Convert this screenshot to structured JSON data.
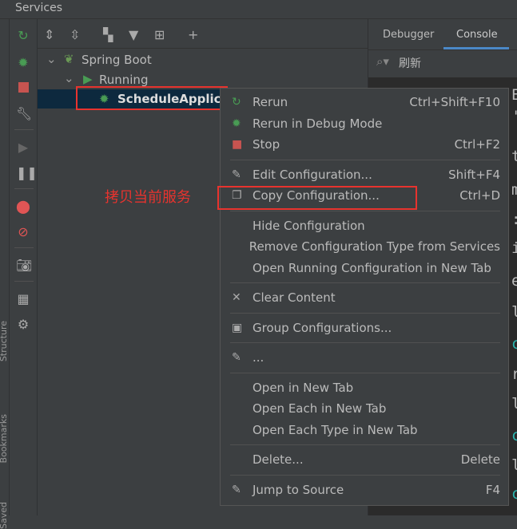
{
  "window": {
    "title": "Services"
  },
  "side_labels": [
    "Structure",
    "Bookmarks",
    "Saved"
  ],
  "tree": {
    "root": "Spring Boot",
    "group": "Running",
    "app": "ScheduleApplicat"
  },
  "right_panel": {
    "tabs": [
      "Debugger",
      "Console"
    ],
    "active_tab": "Console",
    "search_value": "刷新"
  },
  "console_chars": [
    "E",
    "'",
    "t",
    "m",
    ":",
    "i",
    "e",
    "l",
    "c",
    "r",
    "l",
    "c",
    "l",
    "c"
  ],
  "annotation": "拷贝当前服务",
  "menu": [
    {
      "label": "Rerun",
      "shortcut": "Ctrl+Shift+F10",
      "icon": "rerun-icon"
    },
    {
      "label": "Rerun in Debug Mode",
      "shortcut": "",
      "icon": "debug-icon"
    },
    {
      "label": "Stop",
      "shortcut": "Ctrl+F2",
      "icon": "stop-icon"
    },
    {
      "sep": true
    },
    {
      "label": "Edit Configuration...",
      "shortcut": "Shift+F4",
      "icon": "edit-icon"
    },
    {
      "label": "Copy Configuration...",
      "shortcut": "Ctrl+D",
      "icon": "copy-icon"
    },
    {
      "sep": true
    },
    {
      "label": "Hide Configuration",
      "shortcut": ""
    },
    {
      "label": "Remove Configuration Type from Services",
      "shortcut": ""
    },
    {
      "label": "Open Running Configuration in New Tab",
      "shortcut": ""
    },
    {
      "sep": true
    },
    {
      "label": "Clear Content",
      "shortcut": "",
      "icon": "clear-icon"
    },
    {
      "sep": true
    },
    {
      "label": "Group Configurations...",
      "shortcut": "",
      "icon": "group-icon"
    },
    {
      "sep": true
    },
    {
      "label": "...",
      "shortcut": "",
      "icon": "pencil-icon"
    },
    {
      "sep": true
    },
    {
      "label": "Open in New Tab",
      "shortcut": ""
    },
    {
      "label": "Open Each in New Tab",
      "shortcut": ""
    },
    {
      "label": "Open Each Type in New Tab",
      "shortcut": ""
    },
    {
      "sep": true
    },
    {
      "label": "Delete...",
      "shortcut": "Delete"
    },
    {
      "sep": true
    },
    {
      "label": "Jump to Source",
      "shortcut": "F4",
      "icon": "jump-icon"
    }
  ],
  "colors": {
    "accent": "#4a88c7",
    "annotation_red": "#e8332e",
    "run_green": "#499c54",
    "stop_red": "#c75450"
  }
}
